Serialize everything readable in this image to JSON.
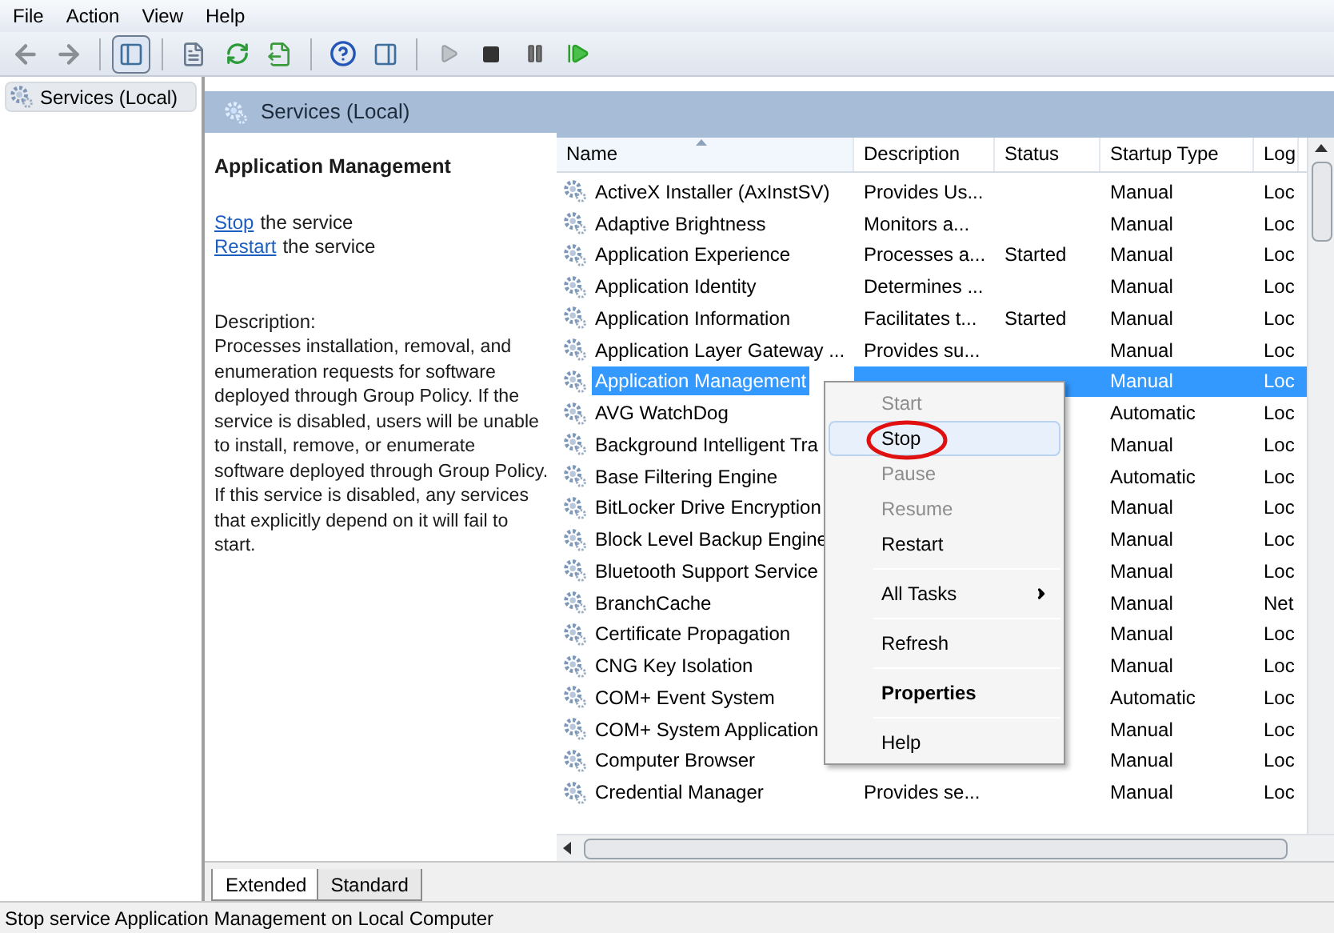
{
  "menu_bar": [
    "File",
    "Action",
    "View",
    "Help"
  ],
  "tree": [
    {
      "label": "Services (Local)",
      "selected": true
    }
  ],
  "pane_title": "Services (Local)",
  "details": {
    "title": "Application Management",
    "actions": [
      {
        "link": "Stop",
        "text": "the service"
      },
      {
        "link": "Restart",
        "text": "the service"
      }
    ],
    "description_label": "Description:",
    "description": "Processes installation, removal, and enumeration requests for software deployed through Group Policy. If the service is disabled, users will be unable to install, remove, or enumerate software deployed through Group Policy. If this service is disabled, any services that explicitly depend on it will fail to start."
  },
  "table": {
    "columns": [
      {
        "label": "Name",
        "sorted": true
      },
      {
        "label": "Description",
        "sorted": false
      },
      {
        "label": "Status",
        "sorted": false
      },
      {
        "label": "Startup Type",
        "sorted": false
      },
      {
        "label": "Log",
        "sorted": false
      }
    ],
    "rows": [
      {
        "name": "ActiveX Installer (AxInstSV)",
        "description": "Provides Us...",
        "startup_type": "Manual",
        "log_on": "Loc",
        "selected": false
      },
      {
        "name": "Adaptive Brightness",
        "description": "Monitors a...",
        "startup_type": "Manual",
        "log_on": "Loc",
        "selected": false
      },
      {
        "name": "Application Experience",
        "description": "Processes a...",
        "status": "Started",
        "startup_type": "Manual",
        "log_on": "Loc",
        "selected": false
      },
      {
        "name": "Application Identity",
        "description": "Determines ...",
        "startup_type": "Manual",
        "log_on": "Loc",
        "selected": false
      },
      {
        "name": "Application Information",
        "description": "Facilitates t...",
        "status": "Started",
        "startup_type": "Manual",
        "log_on": "Loc",
        "selected": false
      },
      {
        "name": "Application Layer Gateway ...",
        "description": "Provides su...",
        "startup_type": "Manual",
        "log_on": "Loc",
        "selected": false
      },
      {
        "name": "Application Management",
        "startup_type": "Manual",
        "log_on": "Loc",
        "selected": true
      },
      {
        "name": "AVG WatchDog",
        "startup_type": "Automatic",
        "log_on": "Loc",
        "selected": false
      },
      {
        "name": "Background Intelligent Tra",
        "startup_type": "Manual",
        "log_on": "Loc",
        "selected": false
      },
      {
        "name": "Base Filtering Engine",
        "startup_type": "Automatic",
        "log_on": "Loc",
        "selected": false
      },
      {
        "name": "BitLocker Drive Encryption",
        "startup_type": "Manual",
        "log_on": "Loc",
        "selected": false
      },
      {
        "name": "Block Level Backup Engine",
        "startup_type": "Manual",
        "log_on": "Loc",
        "selected": false
      },
      {
        "name": "Bluetooth Support Service",
        "startup_type": "Manual",
        "log_on": "Loc",
        "selected": false
      },
      {
        "name": "BranchCache",
        "startup_type": "Manual",
        "log_on": "Net",
        "selected": false
      },
      {
        "name": "Certificate Propagation",
        "startup_type": "Manual",
        "log_on": "Loc",
        "selected": false
      },
      {
        "name": "CNG Key Isolation",
        "startup_type": "Manual",
        "log_on": "Loc",
        "selected": false
      },
      {
        "name": "COM+ Event System",
        "startup_type": "Automatic",
        "log_on": "Loc",
        "selected": false
      },
      {
        "name": "COM+ System Application",
        "startup_type": "Manual",
        "log_on": "Loc",
        "selected": false
      },
      {
        "name": "Computer Browser",
        "startup_type": "Manual",
        "log_on": "Loc",
        "selected": false
      },
      {
        "name": "Credential Manager",
        "description": "Provides se...",
        "startup_type": "Manual",
        "log_on": "Loc",
        "selected": false
      }
    ]
  },
  "context_menu": [
    {
      "kind": "item",
      "label": "Start",
      "disabled": true,
      "highlighted": false,
      "default": false,
      "submenu": false,
      "circled": false
    },
    {
      "kind": "item",
      "label": "Stop",
      "disabled": false,
      "highlighted": true,
      "default": false,
      "submenu": false,
      "circled": true
    },
    {
      "kind": "item",
      "label": "Pause",
      "disabled": true,
      "highlighted": false,
      "default": false,
      "submenu": false,
      "circled": false
    },
    {
      "kind": "item",
      "label": "Resume",
      "disabled": true,
      "highlighted": false,
      "default": false,
      "submenu": false,
      "circled": false
    },
    {
      "kind": "item",
      "label": "Restart",
      "disabled": false,
      "highlighted": false,
      "default": false,
      "submenu": false,
      "circled": false
    },
    {
      "kind": "separator"
    },
    {
      "kind": "item",
      "label": "All Tasks",
      "disabled": false,
      "highlighted": false,
      "default": false,
      "submenu": true,
      "circled": false
    },
    {
      "kind": "separator"
    },
    {
      "kind": "item",
      "label": "Refresh",
      "disabled": false,
      "highlighted": false,
      "default": false,
      "submenu": false,
      "circled": false
    },
    {
      "kind": "separator"
    },
    {
      "kind": "item",
      "label": "Properties",
      "disabled": false,
      "highlighted": false,
      "default": true,
      "submenu": false,
      "circled": false
    },
    {
      "kind": "separator"
    },
    {
      "kind": "item",
      "label": "Help",
      "disabled": false,
      "highlighted": false,
      "default": false,
      "submenu": false,
      "circled": false
    }
  ],
  "tabs": [
    {
      "label": "Extended",
      "selected": true
    },
    {
      "label": "Standard",
      "selected": false
    }
  ],
  "status_bar": "Stop service Application Management on Local Computer"
}
